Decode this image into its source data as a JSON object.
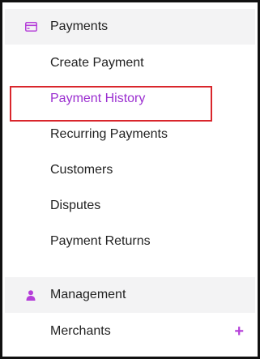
{
  "payments_section": {
    "label": "Payments",
    "icon": "card-icon",
    "accent": "#9b2fd0"
  },
  "payments_items": [
    {
      "label": "Create Payment"
    },
    {
      "label": "Payment History",
      "active": true
    },
    {
      "label": "Recurring Payments"
    },
    {
      "label": "Customers"
    },
    {
      "label": "Disputes"
    },
    {
      "label": "Payment Returns"
    }
  ],
  "management_section": {
    "label": "Management",
    "icon": "user-icon"
  },
  "management_items": [
    {
      "label": "Merchants",
      "action_icon": "plus-icon",
      "action_symbol": "+"
    }
  ],
  "highlight_color": "#d9262c"
}
